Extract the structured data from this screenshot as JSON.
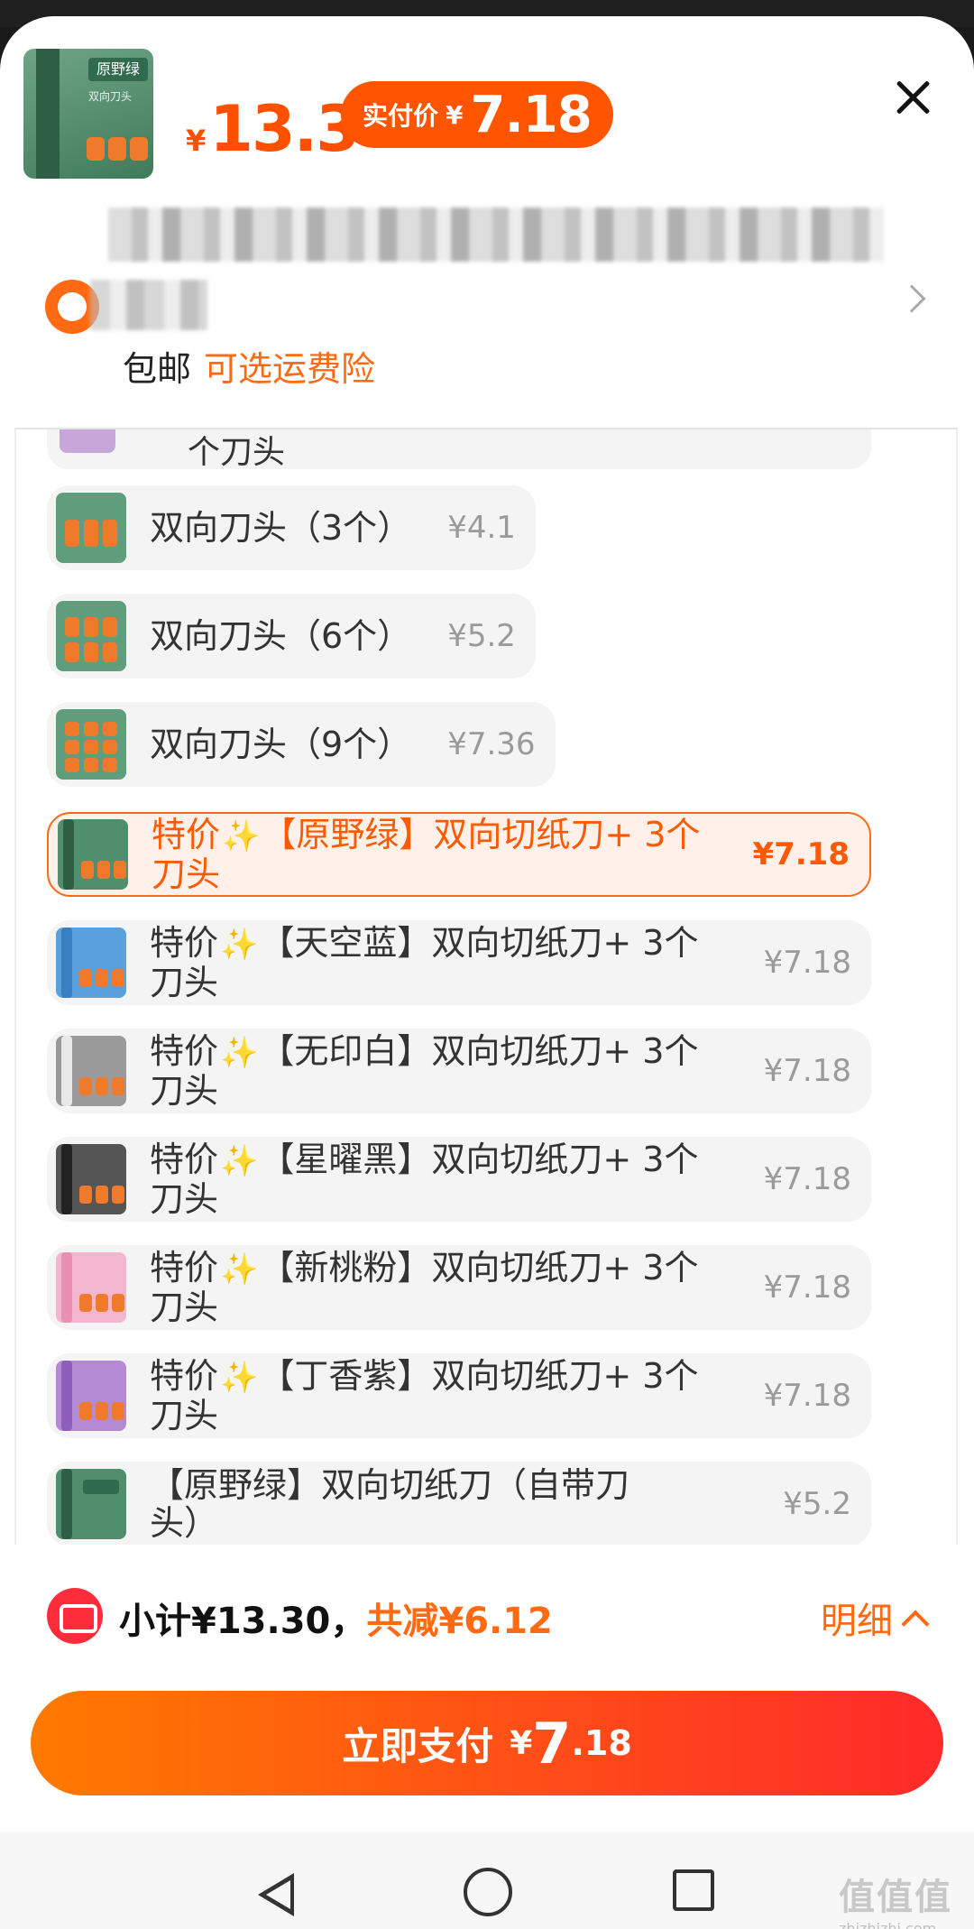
{
  "header": {
    "product_thumb_tag": "原野绿",
    "product_thumb_sub": "双向刀头",
    "price_symbol": "¥",
    "price": "13.3",
    "pay_label": "实付价",
    "pay_symbol": "¥",
    "pay_value": "7.18"
  },
  "shipping": {
    "free": "包邮",
    "insurance": "可选运费险"
  },
  "list": {
    "cut_text": "个刀头",
    "items": [
      {
        "name": "双向刀头（3个）",
        "price": "¥4.1",
        "selected": false
      },
      {
        "name": "双向刀头（6个）",
        "price": "¥5.2",
        "selected": false
      },
      {
        "name": "双向刀头（9个）",
        "price": "¥7.36",
        "selected": false
      },
      {
        "prefix": "特价",
        "spark": "✨",
        "name": "【原野绿】双向切纸刀+ 3个",
        "line2": "刀头",
        "price": "¥7.18",
        "selected": true
      },
      {
        "prefix": "特价",
        "spark": "✨",
        "name": "【天空蓝】双向切纸刀+ 3个",
        "line2": "刀头",
        "price": "¥7.18",
        "selected": false
      },
      {
        "prefix": "特价",
        "spark": "✨",
        "name": "【无印白】双向切纸刀+ 3个",
        "line2": "刀头",
        "price": "¥7.18",
        "selected": false
      },
      {
        "prefix": "特价",
        "spark": "✨",
        "name": "【星曜黑】双向切纸刀+ 3个",
        "line2": "刀头",
        "price": "¥7.18",
        "selected": false
      },
      {
        "prefix": "特价",
        "spark": "✨",
        "name": "【新桃粉】双向切纸刀+ 3个",
        "line2": "刀头",
        "price": "¥7.18",
        "selected": false
      },
      {
        "prefix": "特价",
        "spark": "✨",
        "name": "【丁香紫】双向切纸刀+ 3个",
        "line2": "刀头",
        "price": "¥7.18",
        "selected": false
      },
      {
        "name": "【原野绿】双向切纸刀（自带刀",
        "line2": "头）",
        "price": "¥5.2",
        "selected": false
      }
    ]
  },
  "footer": {
    "subtotal": "小计¥13.30，",
    "discount": "共减¥6.12",
    "detail": "明细",
    "pay_label": "立即支付",
    "pay_symbol": "¥",
    "pay_int": "7",
    "pay_dec": ".18"
  },
  "watermark": {
    "logo": "值值值",
    "url": "zhizhizhi.com"
  },
  "colors": {
    "accent": "#ff5000",
    "pay_gradient_start": "#ff7a00",
    "pay_gradient_end": "#ff2a2a"
  }
}
